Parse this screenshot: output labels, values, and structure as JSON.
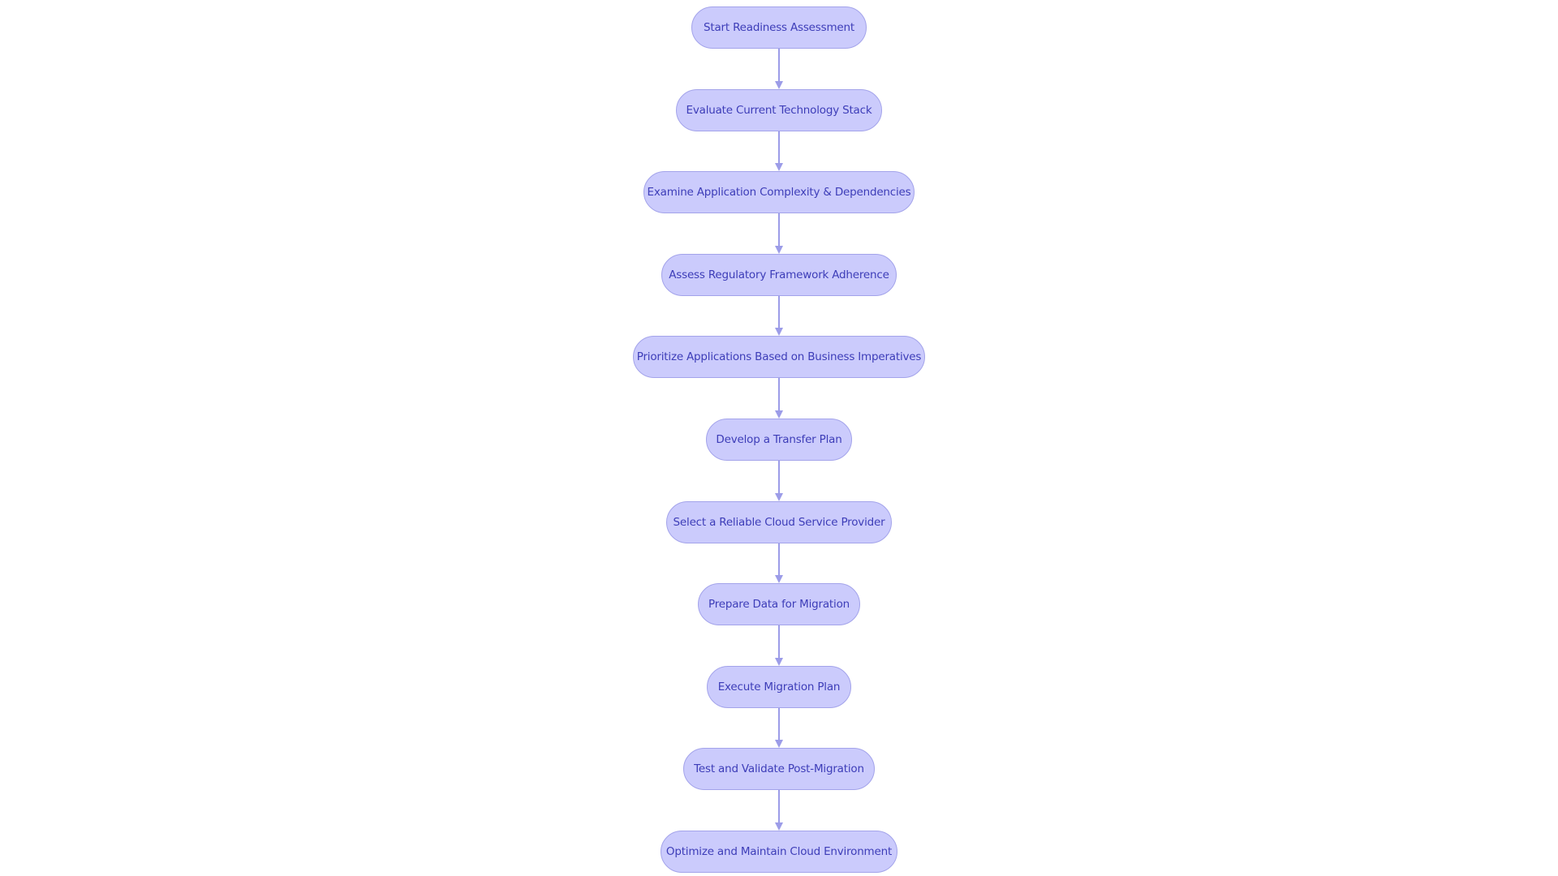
{
  "diagram": {
    "type": "flowchart",
    "direction": "top-down",
    "colors": {
      "node_fill": "#cbcbfc",
      "node_border": "#a3a3ea",
      "node_text": "#3d3db8",
      "edge": "#9c9ce8"
    },
    "nodes": [
      {
        "id": "n1",
        "label": "Start Readiness Assessment"
      },
      {
        "id": "n2",
        "label": "Evaluate Current Technology Stack"
      },
      {
        "id": "n3",
        "label": "Examine Application Complexity & Dependencies"
      },
      {
        "id": "n4",
        "label": "Assess Regulatory Framework Adherence"
      },
      {
        "id": "n5",
        "label": "Prioritize Applications Based on Business Imperatives"
      },
      {
        "id": "n6",
        "label": "Develop a Transfer Plan"
      },
      {
        "id": "n7",
        "label": "Select a Reliable Cloud Service Provider"
      },
      {
        "id": "n8",
        "label": "Prepare Data for Migration"
      },
      {
        "id": "n9",
        "label": "Execute Migration Plan"
      },
      {
        "id": "n10",
        "label": "Test and Validate Post-Migration"
      },
      {
        "id": "n11",
        "label": "Optimize and Maintain Cloud Environment"
      }
    ],
    "edges": [
      {
        "from": "n1",
        "to": "n2"
      },
      {
        "from": "n2",
        "to": "n3"
      },
      {
        "from": "n3",
        "to": "n4"
      },
      {
        "from": "n4",
        "to": "n5"
      },
      {
        "from": "n5",
        "to": "n6"
      },
      {
        "from": "n6",
        "to": "n7"
      },
      {
        "from": "n7",
        "to": "n8"
      },
      {
        "from": "n8",
        "to": "n9"
      },
      {
        "from": "n9",
        "to": "n10"
      },
      {
        "from": "n10",
        "to": "n11"
      }
    ]
  }
}
